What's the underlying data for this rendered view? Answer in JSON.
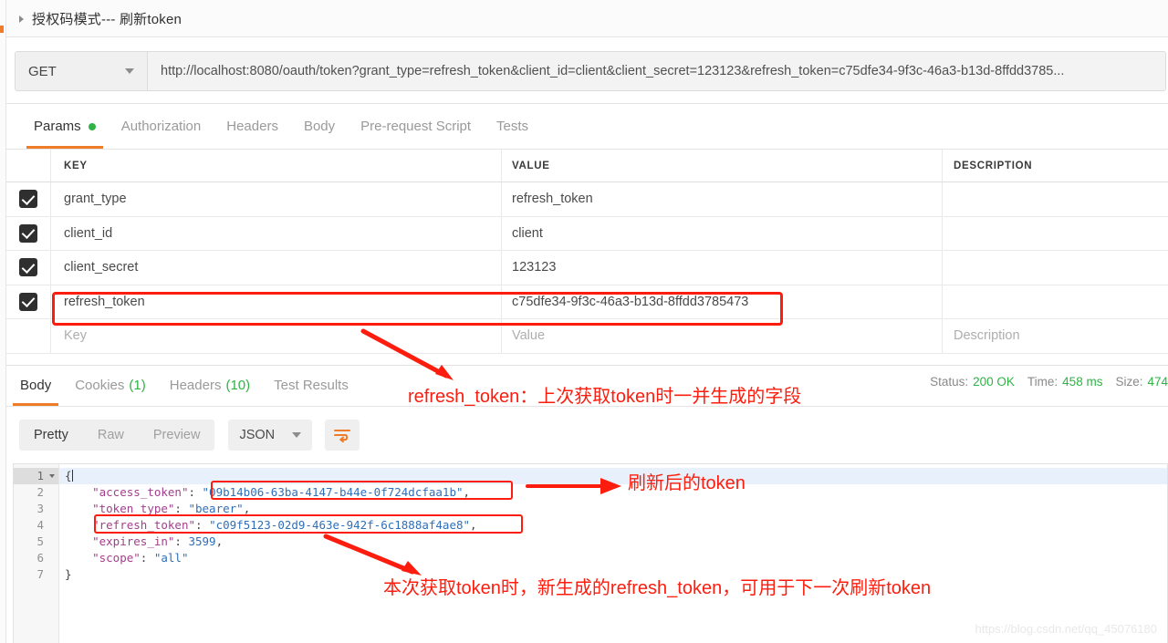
{
  "request": {
    "title": "授权码模式--- 刷新token",
    "method": "GET",
    "url": "http://localhost:8080/oauth/token?grant_type=refresh_token&client_id=client&client_secret=123123&refresh_token=c75dfe34-9f3c-46a3-b13d-8ffdd3785...",
    "tabs": [
      {
        "label": "Params",
        "active": true,
        "dot": true
      },
      {
        "label": "Authorization",
        "active": false,
        "dot": false
      },
      {
        "label": "Headers",
        "active": false,
        "dot": false
      },
      {
        "label": "Body",
        "active": false,
        "dot": false
      },
      {
        "label": "Pre-request Script",
        "active": false,
        "dot": false
      },
      {
        "label": "Tests",
        "active": false,
        "dot": false
      }
    ]
  },
  "params": {
    "headers": {
      "key": "KEY",
      "value": "VALUE",
      "description": "DESCRIPTION"
    },
    "rows": [
      {
        "checked": true,
        "key": "grant_type",
        "value": "refresh_token",
        "description": ""
      },
      {
        "checked": true,
        "key": "client_id",
        "value": "client",
        "description": ""
      },
      {
        "checked": true,
        "key": "client_secret",
        "value": "123123",
        "description": ""
      },
      {
        "checked": true,
        "key": "refresh_token",
        "value": "c75dfe34-9f3c-46a3-b13d-8ffdd3785473",
        "description": ""
      }
    ],
    "placeholder_row": {
      "key": "Key",
      "value": "Value",
      "description": "Description"
    }
  },
  "response": {
    "tabs": [
      {
        "label": "Body",
        "count": "",
        "active": true
      },
      {
        "label": "Cookies",
        "count": "(1)",
        "active": false
      },
      {
        "label": "Headers",
        "count": "(10)",
        "active": false
      },
      {
        "label": "Test Results",
        "count": "",
        "active": false
      }
    ],
    "meta": {
      "status_label": "Status:",
      "status_value": "200 OK",
      "time_label": "Time:",
      "time_value": "458 ms",
      "size_label": "Size:",
      "size_value": "474"
    },
    "toolbar": {
      "segments": [
        {
          "label": "Pretty",
          "active": true
        },
        {
          "label": "Raw",
          "active": false
        },
        {
          "label": "Preview",
          "active": false
        }
      ],
      "format": "JSON",
      "wrap_icon": "word-wrap-icon"
    },
    "code": {
      "line_numbers": [
        "1",
        "2",
        "3",
        "4",
        "5",
        "6",
        "7"
      ],
      "lines": [
        {
          "type": "brace",
          "text": "{"
        },
        {
          "type": "pair",
          "key": "\"access_token\"",
          "value": "\"09b14b06-63ba-4147-b44e-0f724dcfaa1b\"",
          "comma": ","
        },
        {
          "type": "pair",
          "key": "\"token_type\"",
          "value": "\"bearer\"",
          "comma": ","
        },
        {
          "type": "pair",
          "key": "\"refresh_token\"",
          "value": "\"c09f5123-02d9-463e-942f-6c1888af4ae8\"",
          "comma": ","
        },
        {
          "type": "pairnum",
          "key": "\"expires_in\"",
          "value": "3599",
          "comma": ","
        },
        {
          "type": "pair",
          "key": "\"scope\"",
          "value": "\"all\"",
          "comma": ""
        },
        {
          "type": "brace",
          "text": "}"
        }
      ]
    }
  },
  "annotations": {
    "note_refresh_param": "refresh_token：上次获取token时一并生成的字段",
    "note_new_token": "刷新后的token",
    "note_new_refresh_token": "本次获取token时，新生成的refresh_token，可用于下一次刷新token"
  },
  "watermark": "https://blog.csdn.net/qq_45076180",
  "colors": {
    "accent": "#ef7c28",
    "annotation_red": "#fc1d0e",
    "status_green": "#2fb344"
  }
}
